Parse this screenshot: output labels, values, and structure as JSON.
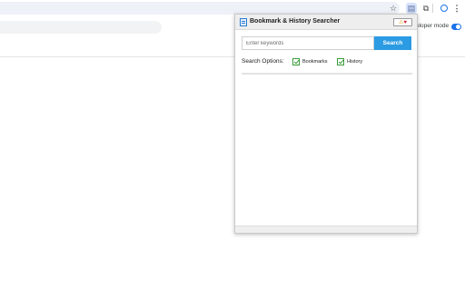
{
  "browser": {
    "dev_mode_label": "eloper mode"
  },
  "popup": {
    "title": "Bookmark & History Searcher",
    "badge": {
      "warn_glyph": "⚠",
      "heart_glyph": "♥"
    },
    "search": {
      "placeholder": "Enter keywords",
      "value": "",
      "button_label": "Search"
    },
    "options": {
      "label": "Search Options:",
      "items": [
        {
          "label": "Bookmarks",
          "checked": true
        },
        {
          "label": "History",
          "checked": true
        }
      ]
    }
  },
  "icons": [
    "star-icon",
    "extension-icon",
    "puzzle-icon",
    "profile-icon",
    "menu-icon",
    "app-icon",
    "warning-icon",
    "heart-icon",
    "checkbox-checked-icon"
  ],
  "colors": {
    "accent": "#2b9be3",
    "toggle": "#1a73e8",
    "checkbox": "#3a9d3a",
    "heart": "#d11f2e"
  }
}
